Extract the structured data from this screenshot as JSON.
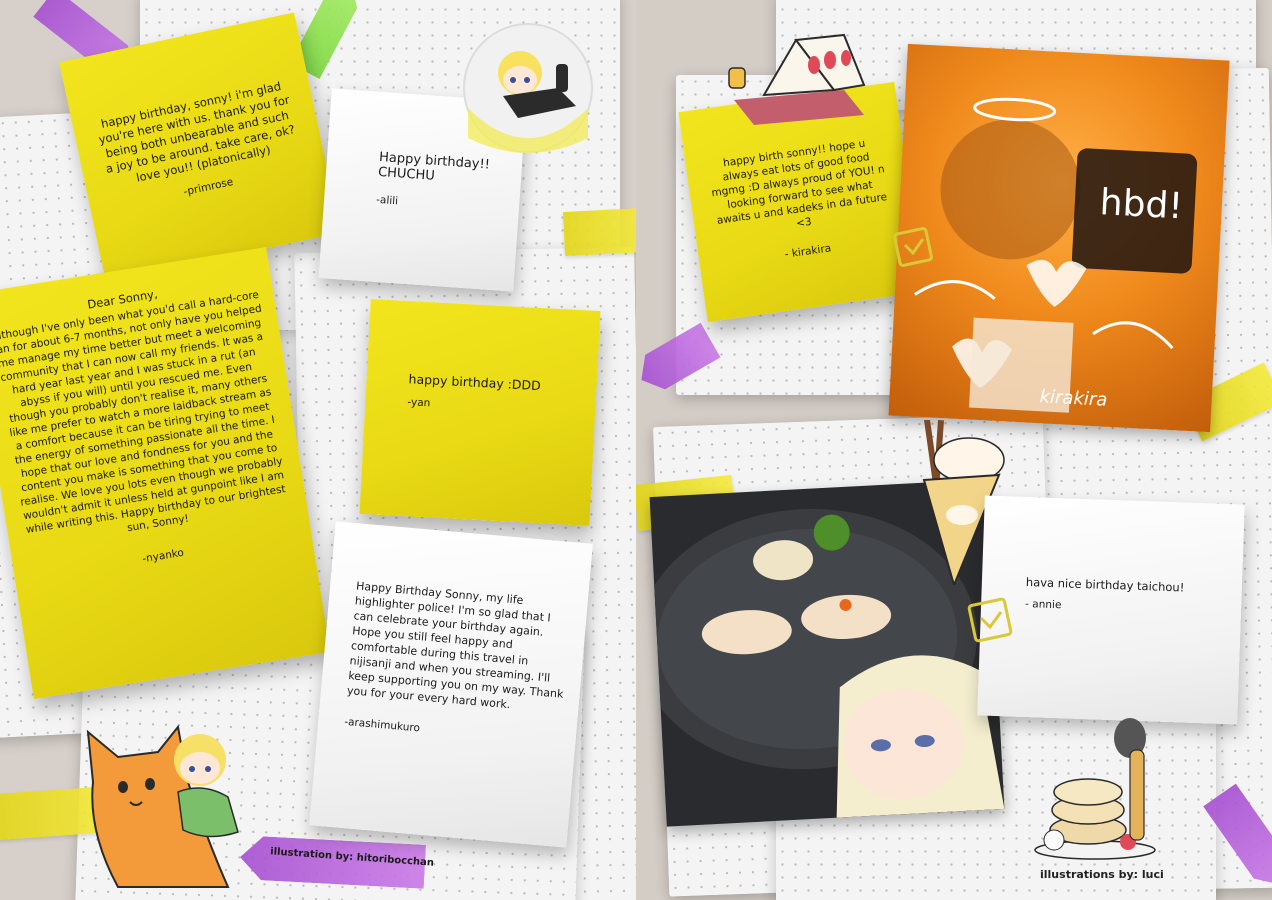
{
  "notes": {
    "primrose": {
      "body": "happy birthday, sonny! i'm glad you're here with us. thank you for being both unbearable and such a joy to be around. take care, ok? love you!! (platonically)",
      "signature": "-primrose"
    },
    "alili": {
      "body": "Happy birthday!! CHUCHU",
      "signature": "-alili"
    },
    "nyanko": {
      "greeting": "Dear Sonny,",
      "body": "Although I've only been what you'd call a hard-core fan for about 6-7 months, not only have you helped me manage my time better but meet a welcoming community that I can now call my friends. It was a hard year last year and I was stuck in a rut (an abyss if you will) until you rescued me. Even though you probably don't realise it, many others like me prefer to watch a more laidback stream as a comfort because it can be tiring trying to meet the energy of something passionate all the time. I hope that our love and fondness for you and the content you make is something that you come to realise. We love you lots even though we probably wouldn't admit it unless held at gunpoint like I am while writing this. Happy birthday to our brightest sun, Sonny!",
      "signature": "-nyanko"
    },
    "yan": {
      "body": "happy birthday :DDD",
      "signature": "-yan"
    },
    "arashimukuro": {
      "body": "Happy Birthday Sonny, my life highlighter police! I'm so glad that I can celebrate your birthday again. Hope you still feel happy and comfortable during this travel in nijisanji and when you streaming. I'll keep supporting you on my way. Thank you for your every hard work.",
      "signature": "-arashimukuro"
    },
    "kirakira": {
      "body": "happy birth sonny!! hope u always eat lots of good food mgmg :D always proud of YOU! n looking forward to see what awaits u and kadeks in da future <3",
      "signature": "- kirakira"
    },
    "annie": {
      "body": "hava nice birthday taichou!",
      "signature": "- annie"
    }
  },
  "photo_text": {
    "hbd": "hbd!",
    "kirakira_tag": "kirakira"
  },
  "credits": {
    "left": "illustration by: hitoribocchan",
    "right": "illustrations by: luci"
  },
  "icons": {
    "sandwich": "strawberry-sandwich-icon",
    "pancake": "pancake-icon",
    "crepe": "crepe-icon"
  },
  "colors": {
    "note_yellow": "#ecdd17",
    "tab_purple": "#b660db",
    "tab_green": "#8fe04c",
    "photo_orange": "#f08a1c"
  }
}
